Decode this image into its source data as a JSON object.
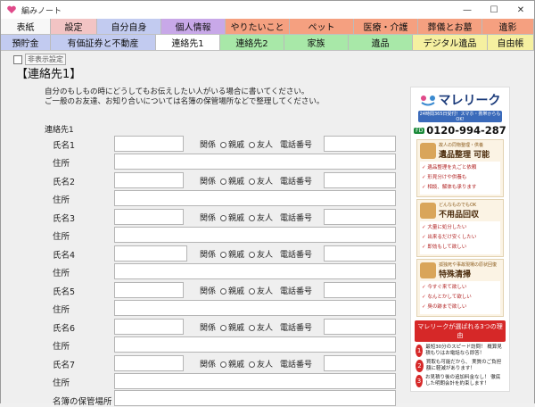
{
  "window": {
    "title": "編みノート",
    "minimize": "—",
    "maximize": "☐",
    "close": "✕"
  },
  "tabs_row1": [
    {
      "label": "表紙",
      "color": "#f7f7f7"
    },
    {
      "label": "設定",
      "color": "#f2c4c4"
    },
    {
      "label": "自分自身",
      "color": "#c2cbf0"
    },
    {
      "label": "個人情報",
      "color": "#c8a8e8"
    },
    {
      "label": "やりたいこと",
      "color": "#f5a080"
    },
    {
      "label": "ペット",
      "color": "#f5a080"
    },
    {
      "label": "医療・介護",
      "color": "#f5a080"
    },
    {
      "label": "葬儀とお墓",
      "color": "#f5a080"
    },
    {
      "label": "遺影",
      "color": "#f5a080"
    }
  ],
  "tabs_row2": [
    {
      "label": "預貯金",
      "color": "#c2cbf0"
    },
    {
      "label": "有価証券と不動産",
      "color": "#c2cbf0"
    },
    {
      "label": "連絡先1",
      "color": "#ffffff"
    },
    {
      "label": "連絡先2",
      "color": "#a8e8a8"
    },
    {
      "label": "家族",
      "color": "#a8e8a8"
    },
    {
      "label": "遺品",
      "color": "#a8e8a8"
    },
    {
      "label": "デジタル遺品",
      "color": "#f5f0a0"
    },
    {
      "label": "自由帳",
      "color": "#f5f0a0"
    }
  ],
  "hide_checkbox_label": "非表示設定",
  "heading": "【連絡先1】",
  "intro": [
    "自分のもしもの時にどうしてもお伝えしたい人がいる場合に書いてください。",
    "ご一般のお友達、お知り合いについては名簿の保管場所などで整理してください。"
  ],
  "section_label": "連絡先1",
  "contacts": [
    {
      "name_label": "氏名1",
      "address_label": "住所"
    },
    {
      "name_label": "氏名2",
      "address_label": "住所"
    },
    {
      "name_label": "氏名3",
      "address_label": "住所"
    },
    {
      "name_label": "氏名4",
      "address_label": "住所"
    },
    {
      "name_label": "氏名5",
      "address_label": "住所"
    },
    {
      "name_label": "氏名6",
      "address_label": "住所"
    },
    {
      "name_label": "氏名7",
      "address_label": "住所"
    }
  ],
  "relation_label": "関係",
  "relation_options": [
    "親戚",
    "友人"
  ],
  "phone_label": "電話番号",
  "roster_label": "名簿の保管場所",
  "ad": {
    "brand": "マレリーク",
    "sub": "24時間365日受付！スマホ・携帯からもOK!",
    "freedial": "FD",
    "tel": "0120-994-287",
    "blocks": [
      {
        "caption": "故人の同物整理・供養",
        "title": "遺品整理 可能",
        "items": [
          "遺品整理を丸ごと依頼",
          "形見分けや供養も",
          "相談、解体も承ります"
        ]
      },
      {
        "caption": "どんなものでもOK",
        "title": "不用品回収",
        "items": [
          "大量に処分したい",
          "出来るだけ安くしたい",
          "即効もして欲しい"
        ]
      },
      {
        "caption": "孤独死や事故現場の原状回復",
        "title": "特殊清掃",
        "items": [
          "今すぐ来て欲しい",
          "なんとかして欲しい",
          "臭の跡まで欲しい"
        ]
      }
    ],
    "reason_title": "マレリークが選ばれる3つの理由",
    "reasons": [
      {
        "n": "1",
        "text": "最短30分のスピード訪問！ 概算見積もりはお電話なら即答！"
      },
      {
        "n": "2",
        "text": "買取も可能だから、 実質のご負担額に軽減があります！"
      },
      {
        "n": "3",
        "text": "お見積り後の追加料金なし！ 徹底した明朗会計を約束します！"
      }
    ]
  }
}
